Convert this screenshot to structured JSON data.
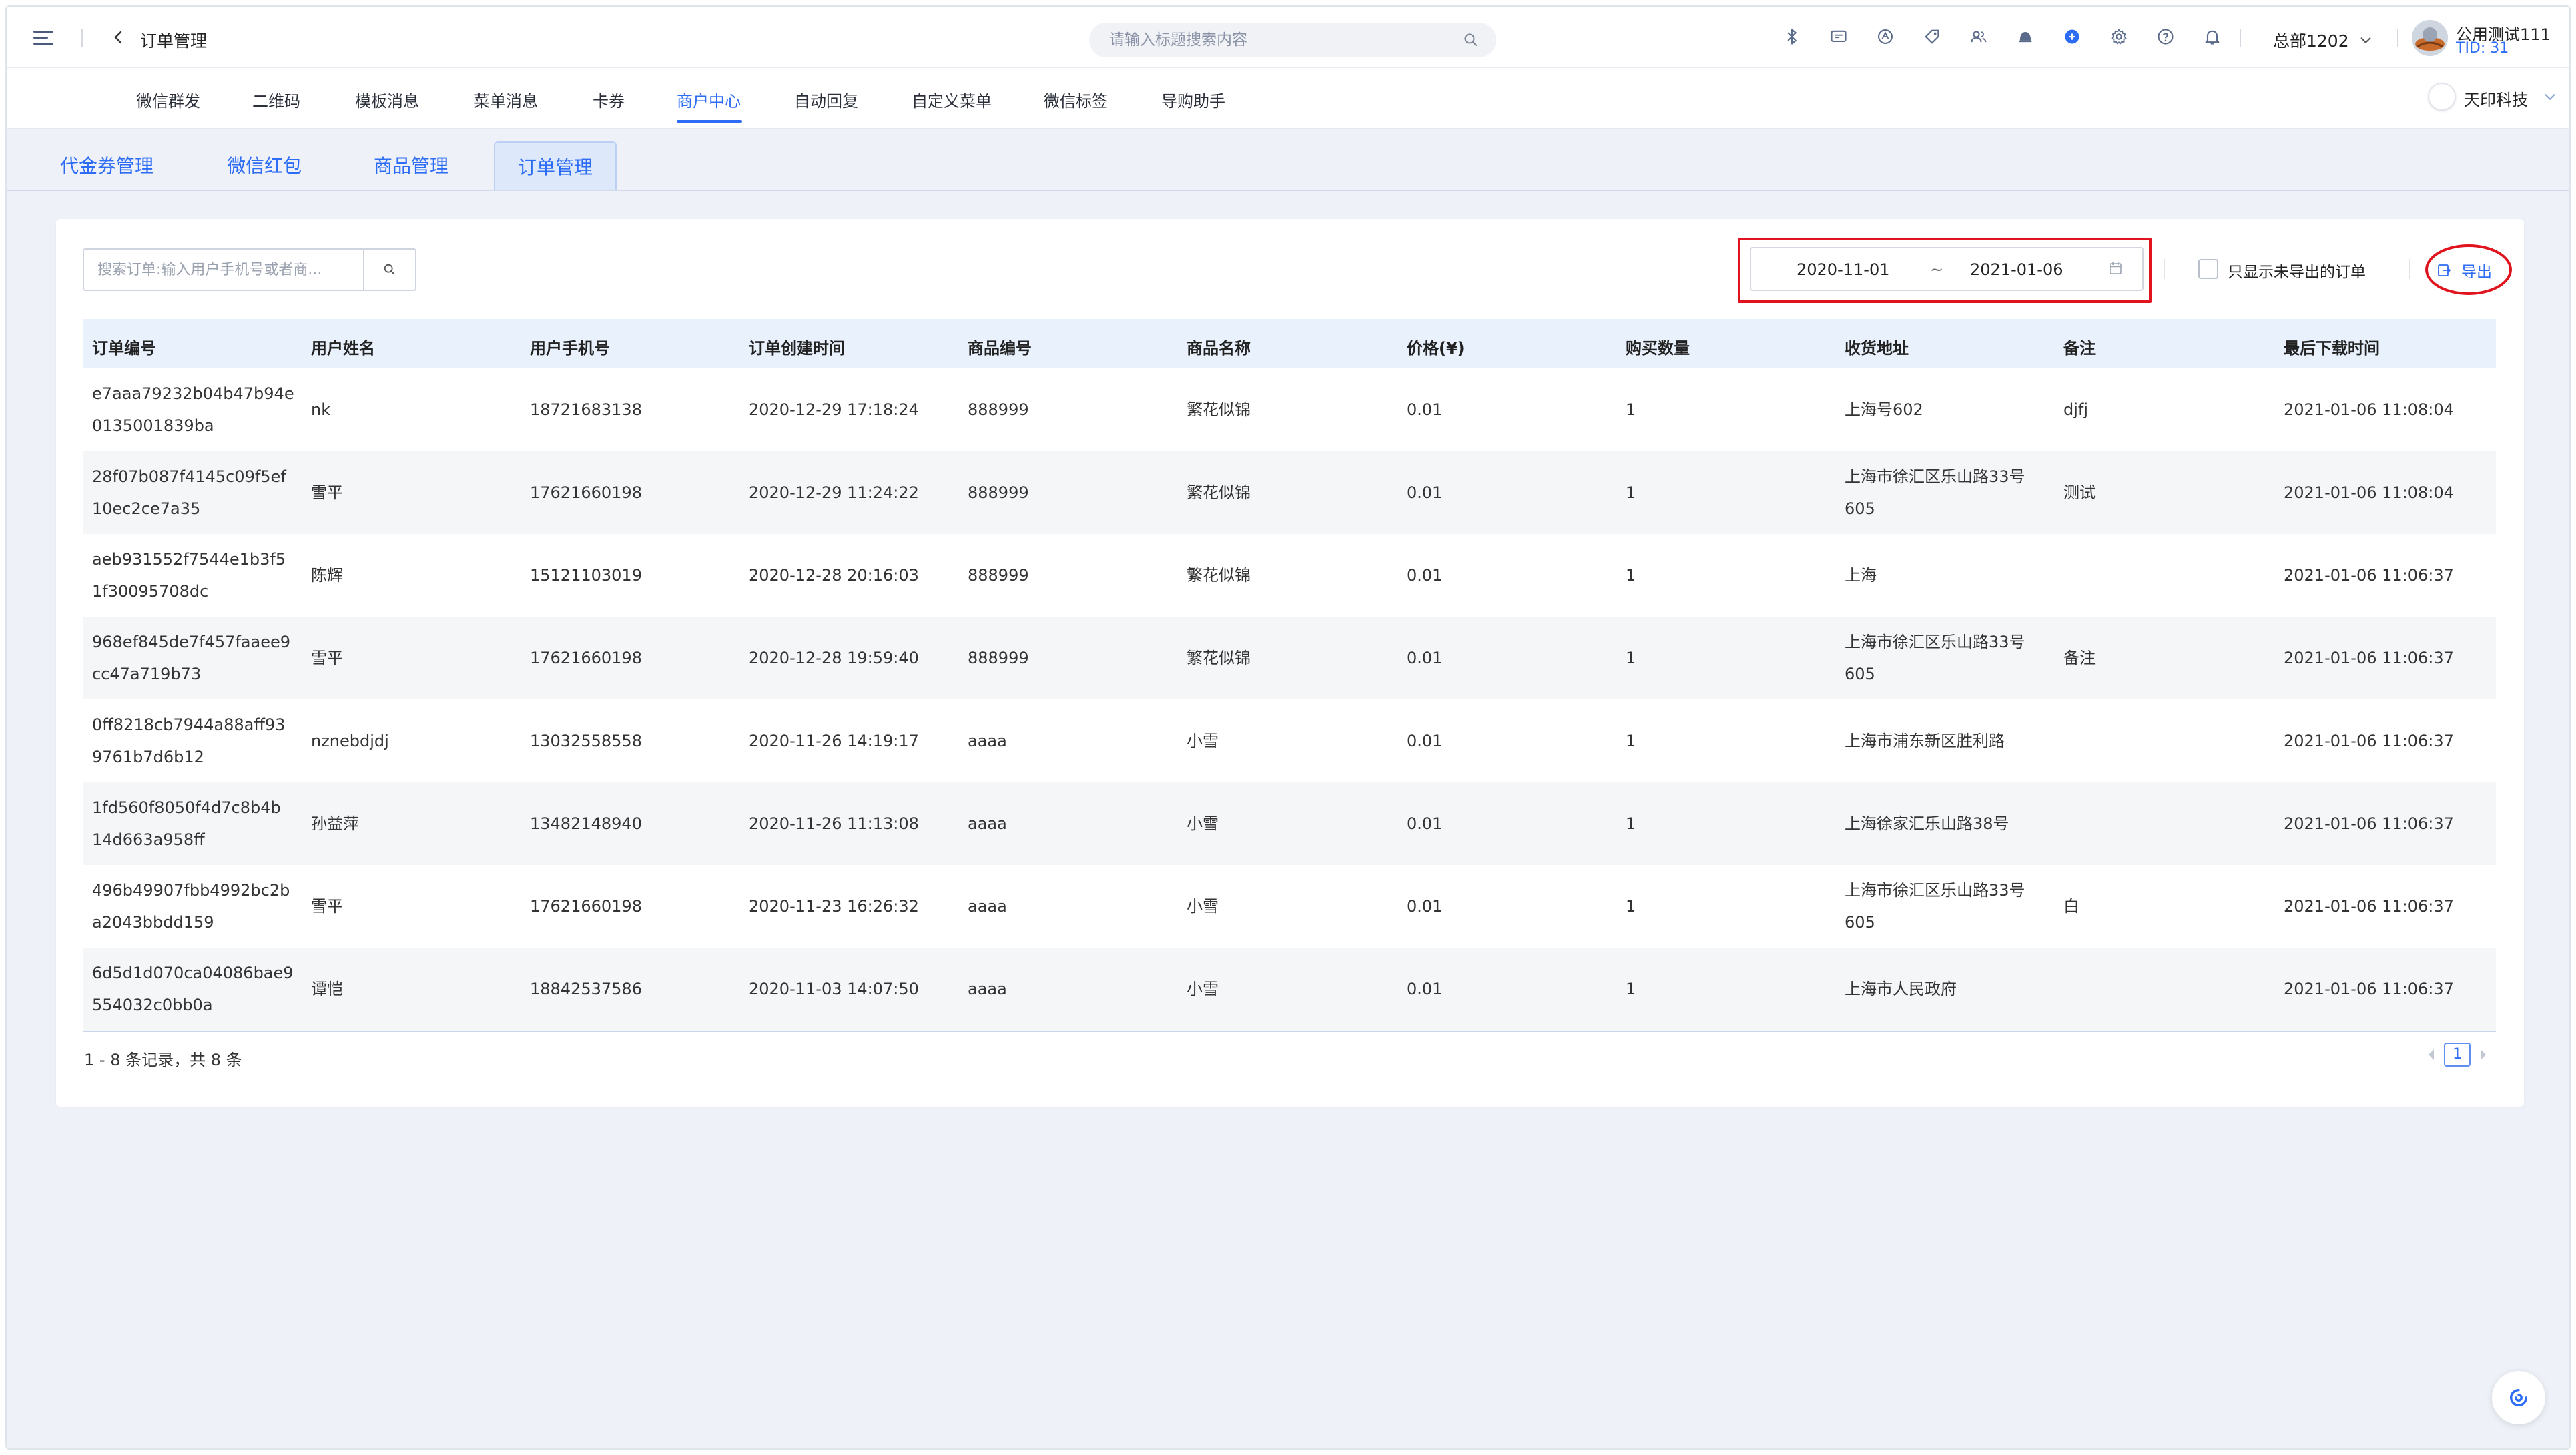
{
  "header": {
    "title": "订单管理",
    "search_placeholder": "请输入标题搜索内容",
    "org": "总部1202",
    "user_name": "公用测试111",
    "user_tid": "TID: 31"
  },
  "toolbar_icons": [
    "bluetooth-icon",
    "message-icon",
    "app-icon",
    "tag-icon",
    "users-icon",
    "bell-alert-icon",
    "dot-icon",
    "gear-icon",
    "help-icon",
    "notification-icon"
  ],
  "nav": {
    "items": [
      "微信群发",
      "二维码",
      "模板消息",
      "菜单消息",
      "卡券",
      "商户中心",
      "自动回复",
      "自定义菜单",
      "微信标签",
      "导购助手"
    ],
    "active": "商户中心",
    "company": "天印科技"
  },
  "subtabs": {
    "items": [
      "代金券管理",
      "微信红包",
      "商品管理",
      "订单管理"
    ],
    "active": "订单管理"
  },
  "filters": {
    "search_placeholder": "搜索订单:输入用户手机号或者商...",
    "date_start": "2020-11-01",
    "date_sep": "~",
    "date_end": "2021-01-06",
    "only_unexported_label": "只显示未导出的订单",
    "export_label": "导出"
  },
  "table": {
    "columns": [
      "订单编号",
      "用户姓名",
      "用户手机号",
      "订单创建时间",
      "商品编号",
      "商品名称",
      "价格(¥)",
      "购买数量",
      "收货地址",
      "备注",
      "最后下载时间"
    ],
    "rows": [
      {
        "id1": "e7aaa79232b04b47b94e",
        "id2": "0135001839ba",
        "name": "nk",
        "phone": "18721683138",
        "created": "2020-12-29 17:18:24",
        "sku": "888999",
        "product": "繁花似锦",
        "price": "0.01",
        "qty": "1",
        "addr1": "上海号602",
        "addr2": "",
        "note": "djfj",
        "downloaded": "2021-01-06 11:08:04"
      },
      {
        "id1": "28f07b087f4145c09f5ef",
        "id2": "10ec2ce7a35",
        "name": "雪平",
        "phone": "17621660198",
        "created": "2020-12-29 11:24:22",
        "sku": "888999",
        "product": "繁花似锦",
        "price": "0.01",
        "qty": "1",
        "addr1": "上海市徐汇区乐山路33号",
        "addr2": "605",
        "note": "测试",
        "downloaded": "2021-01-06 11:08:04"
      },
      {
        "id1": "aeb931552f7544e1b3f5",
        "id2": "1f30095708dc",
        "name": "陈辉",
        "phone": "15121103019",
        "created": "2020-12-28 20:16:03",
        "sku": "888999",
        "product": "繁花似锦",
        "price": "0.01",
        "qty": "1",
        "addr1": "上海",
        "addr2": "",
        "note": "",
        "downloaded": "2021-01-06 11:06:37"
      },
      {
        "id1": "968ef845de7f457faaee9",
        "id2": "cc47a719b73",
        "name": "雪平",
        "phone": "17621660198",
        "created": "2020-12-28 19:59:40",
        "sku": "888999",
        "product": "繁花似锦",
        "price": "0.01",
        "qty": "1",
        "addr1": "上海市徐汇区乐山路33号",
        "addr2": "605",
        "note": "备注",
        "downloaded": "2021-01-06 11:06:37"
      },
      {
        "id1": "0ff8218cb7944a88aff93",
        "id2": "9761b7d6b12",
        "name": "nznebdjdj",
        "phone": "13032558558",
        "created": "2020-11-26 14:19:17",
        "sku": "aaaa",
        "product": "小雪",
        "price": "0.01",
        "qty": "1",
        "addr1": "上海市浦东新区胜利路",
        "addr2": "",
        "note": "",
        "downloaded": "2021-01-06 11:06:37"
      },
      {
        "id1": "1fd560f8050f4d7c8b4b",
        "id2": "14d663a958ff",
        "name": "孙益萍",
        "phone": "13482148940",
        "created": "2020-11-26 11:13:08",
        "sku": "aaaa",
        "product": "小雪",
        "price": "0.01",
        "qty": "1",
        "addr1": "上海徐家汇乐山路38号",
        "addr2": "",
        "note": "",
        "downloaded": "2021-01-06 11:06:37"
      },
      {
        "id1": "496b49907fbb4992bc2b",
        "id2": "a2043bbdd159",
        "name": "雪平",
        "phone": "17621660198",
        "created": "2020-11-23 16:26:32",
        "sku": "aaaa",
        "product": "小雪",
        "price": "0.01",
        "qty": "1",
        "addr1": "上海市徐汇区乐山路33号",
        "addr2": "605",
        "note": "白",
        "downloaded": "2021-01-06 11:06:37"
      },
      {
        "id1": "6d5d1d070ca04086bae9",
        "id2": "554032c0bb0a",
        "name": "谭恺",
        "phone": "18842537586",
        "created": "2020-11-03 14:07:50",
        "sku": "aaaa",
        "product": "小雪",
        "price": "0.01",
        "qty": "1",
        "addr1": "上海市人民政府",
        "addr2": "",
        "note": "",
        "downloaded": "2021-01-06 11:06:37"
      }
    ]
  },
  "pagination": {
    "info": "1 - 8 条记录，共 8 条",
    "current_page": "1"
  },
  "colors": {
    "accent": "#2d6cf5",
    "highlight_red": "#e0141e",
    "header_row_bg": "#e8f1fc"
  }
}
